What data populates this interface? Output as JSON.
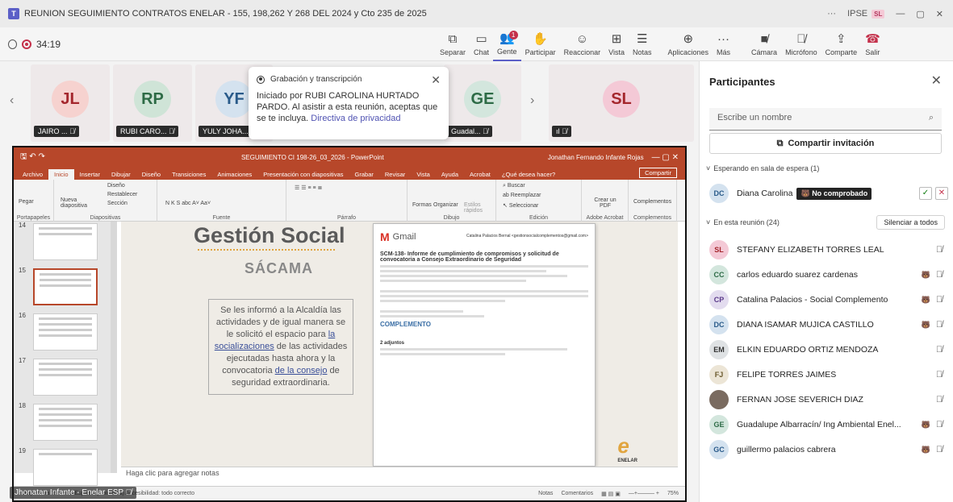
{
  "window": {
    "title": "REUNION SEGUIMIENTO CONTRATOS ENELAR - 155, 198,262 Y 268 DEL 2024 y Cto 235 de 2025",
    "org": "IPSE",
    "user_initials": "SL"
  },
  "toolbar": {
    "timer": "34:19",
    "items": [
      {
        "label": "Separar",
        "icon": "popout-icon"
      },
      {
        "label": "Chat",
        "icon": "chat-icon"
      },
      {
        "label": "Gente",
        "icon": "people-icon",
        "badge": "1"
      },
      {
        "label": "Participar",
        "icon": "raise-hand-icon"
      },
      {
        "label": "Reaccionar",
        "icon": "smile-icon"
      },
      {
        "label": "Vista",
        "icon": "view-icon"
      },
      {
        "label": "Notas",
        "icon": "notes-icon"
      },
      {
        "label": "Aplicaciones",
        "icon": "apps-icon"
      },
      {
        "label": "Más",
        "icon": "more-icon"
      },
      {
        "label": "Cámara",
        "icon": "camera-off-icon"
      },
      {
        "label": "Micrófono",
        "icon": "mic-off-icon"
      },
      {
        "label": "Comparte",
        "icon": "share-icon"
      },
      {
        "label": "Salir",
        "icon": "hangup-icon"
      }
    ]
  },
  "tiles": [
    {
      "initials": "JL",
      "name": "JAIRO ...",
      "bg": "#f6d2cf",
      "fg": "#a4262c"
    },
    {
      "initials": "RP",
      "name": "RUBI CARO...",
      "bg": "#cfe4d7",
      "fg": "#2d6b46"
    },
    {
      "initials": "YF",
      "name": "YULY JOHA...",
      "bg": "#d4e2ef",
      "fg": "#2a5b8a"
    },
    {
      "initials": "GE",
      "name": "Guadal...",
      "bg": "#d3e6dd",
      "fg": "#2d6b46"
    },
    {
      "initials": "SL",
      "name": "",
      "bg": "#f4c9d6",
      "fg": "#a4262c"
    }
  ],
  "recording_popup": {
    "title": "Grabación y transcripción",
    "text": "Iniciado por RUBI CAROLINA HURTADO PARDO. Al asistir a esta reunión, aceptas que se te incluya.",
    "link": "Directiva de privacidad"
  },
  "ppt": {
    "doc_title": "SEGUIMIENTO CI 198-26_03_2026 - PowerPoint",
    "user": "Jonathan Fernando Infante Rojas",
    "tabs": [
      "Archivo",
      "Inicio",
      "Insertar",
      "Dibujar",
      "Diseño",
      "Transiciones",
      "Animaciones",
      "Presentación con diapositivas",
      "Grabar",
      "Revisar",
      "Vista",
      "Ayuda",
      "Acrobat",
      "¿Qué desea hacer?"
    ],
    "share": "Compartir",
    "ribbon_groups": [
      "Portapapeles",
      "Diapositivas",
      "Fuente",
      "Párrafo",
      "Dibujo",
      "Edición",
      "Adobe Acrobat",
      "Complementos"
    ],
    "ribbon_items": {
      "pegar": "Pegar",
      "nueva": "Nueva diapositiva",
      "diseno": "Diseño",
      "restablecer": "Restablecer",
      "seccion": "Sección",
      "formas": "Formas",
      "organizar": "Organizar",
      "estilos": "Estilos rápidos",
      "buscar": "Buscar",
      "reemplazar": "Reemplazar",
      "seleccionar": "Seleccionar",
      "crear_pdf": "Crear un PDF",
      "complementos": "Complementos"
    },
    "thumbs": [
      "14",
      "15",
      "16",
      "17",
      "18",
      "19"
    ],
    "slide": {
      "title": "Gestión Social",
      "subtitle": "SÁCAMA",
      "p1": "Se les informó a la Alcaldía las actividades y de igual manera se le solicitó el espacio para ",
      "u1": "la socializaciones",
      "p2": " de las actividades ejecutadas hasta ahora y la convocatoria ",
      "u2": "de la consejo",
      "p3": " de seguridad extraordinaria.",
      "email_brand": "Gmail",
      "email_sender": "Catalina Palacios Bernal <gestionsocialcomplementos@gmail.com>",
      "email_subject": "SCM-138- Informe de cumplimiento de compromisos y solicitud de convocatoria a Consejo Extraordinario de Seguridad",
      "email_logo": "COMPLEMENTO",
      "email_attachments": "2 adjuntos",
      "brand": "ENELAR"
    },
    "notes": "Haga clic para agregar notas",
    "status_left": "Diapositiva 15 de 45   Español (Colombia)   Accesibilidad: todo correcto",
    "status_notes": "Notas",
    "status_comments": "Comentarios",
    "zoom": "75%"
  },
  "presenter": "Jhonatan Infante - Enelar ESP",
  "panel": {
    "title": "Participantes",
    "search_placeholder": "Escribe un nombre",
    "invite": "Compartir invitación",
    "lobby_header": "Esperando en sala de espera (1)",
    "lobby": {
      "initials": "DC",
      "name": "Diana Carolina",
      "badge": "No comprobado"
    },
    "meeting_header": "En esta reunión (24)",
    "mute_all": "Silenciar a todos",
    "people": [
      {
        "initials": "SL",
        "name": "STEFANY ELIZABETH TORRES LEAL",
        "bg": "#f4c9d6",
        "fg": "#a4262c",
        "ext": false
      },
      {
        "initials": "CC",
        "name": "carlos eduardo suarez cardenas",
        "bg": "#d3e6dd",
        "fg": "#2d6b46",
        "ext": true
      },
      {
        "initials": "CP",
        "name": "Catalina Palacios - Social Complemento",
        "bg": "#e3dcef",
        "fg": "#5b3a8a",
        "ext": true
      },
      {
        "initials": "DC",
        "name": "DIANA ISAMAR MUJICA CASTILLO",
        "bg": "#d4e2ef",
        "fg": "#2a5b8a",
        "ext": true
      },
      {
        "initials": "EM",
        "name": "ELKIN EDUARDO ORTIZ MENDOZA",
        "bg": "#dfe2e4",
        "fg": "#333333",
        "ext": false
      },
      {
        "initials": "FJ",
        "name": "FELIPE TORRES JAIMES",
        "bg": "#ece5d6",
        "fg": "#6b5a2d",
        "ext": false
      },
      {
        "initials": "",
        "name": "FERNAN JOSE SEVERICH DIAZ",
        "bg": "#7a6b60",
        "fg": "#ffffff",
        "ext": false
      },
      {
        "initials": "GE",
        "name": "Guadalupe Albarracín/ Ing Ambiental Enel...",
        "bg": "#d3e6dd",
        "fg": "#2d6b46",
        "ext": true
      },
      {
        "initials": "GC",
        "name": "guillermo palacios cabrera",
        "bg": "#d4e2ef",
        "fg": "#2a5b8a",
        "ext": true
      }
    ]
  }
}
